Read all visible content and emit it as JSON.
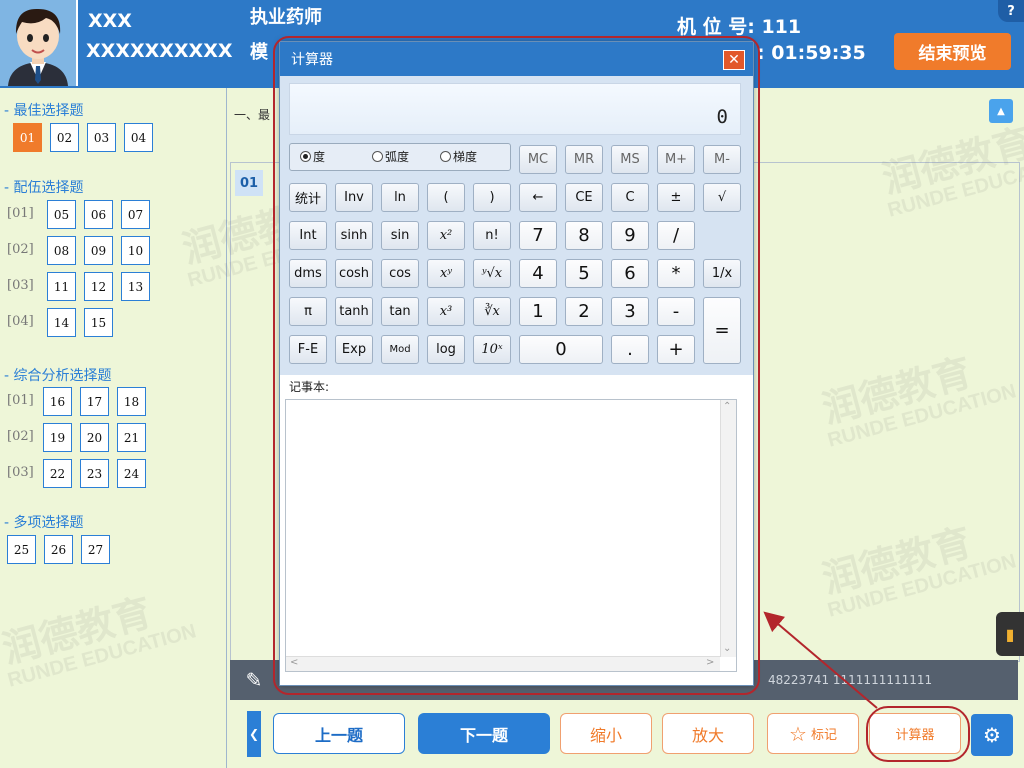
{
  "header": {
    "user_name": "XXX",
    "user_id": "XXXXXXXXXX",
    "exam_title": "执业药师",
    "exam_mode": "模",
    "seat_label": "机 位 号: 111",
    "timer": ": 01:59:35",
    "end_button": "结束预览",
    "help_icon": "?"
  },
  "sidebar": {
    "sections": [
      {
        "title": "- 最佳选择题",
        "groups": [
          {
            "label": "",
            "items": [
              "01",
              "02",
              "03",
              "04"
            ]
          }
        ]
      },
      {
        "title": "- 配伍选择题",
        "groups": [
          {
            "label": "[01]",
            "items": [
              "05",
              "06",
              "07"
            ]
          },
          {
            "label": "[02]",
            "items": [
              "08",
              "09",
              "10"
            ]
          },
          {
            "label": "[03]",
            "items": [
              "11",
              "12",
              "13"
            ]
          },
          {
            "label": "[04]",
            "items": [
              "14",
              "15"
            ]
          }
        ]
      },
      {
        "title": "- 综合分析选择题",
        "groups": [
          {
            "label": "[01]",
            "items": [
              "16",
              "17",
              "18"
            ]
          },
          {
            "label": "[02]",
            "items": [
              "19",
              "20",
              "21"
            ]
          },
          {
            "label": "[03]",
            "items": [
              "22",
              "23",
              "24"
            ]
          }
        ]
      },
      {
        "title": "- 多项选择题",
        "groups": [
          {
            "label": "",
            "items": [
              "25",
              "26",
              "27"
            ]
          }
        ]
      }
    ],
    "active_item": "01"
  },
  "main": {
    "heading": "一、最",
    "question_number": "01",
    "status_text": "48223741 1111111111111"
  },
  "toolbar": {
    "prev": "上一题",
    "next": "下一题",
    "shrink": "缩小",
    "enlarge": "放大",
    "mark": "标记",
    "calculator": "计算器"
  },
  "calculator": {
    "title": "计算器",
    "close": "✕",
    "display": "0",
    "angle_modes": [
      "度",
      "弧度",
      "梯度"
    ],
    "selected_mode": "度",
    "memory_keys": [
      "MC",
      "MR",
      "MS",
      "M+",
      "M-"
    ],
    "rows": [
      [
        "统计",
        "Inv",
        "ln",
        "(",
        ")",
        "←",
        "CE",
        "C",
        "±",
        "√"
      ],
      [
        "Int",
        "sinh",
        "sin",
        "x²",
        "n!",
        "7",
        "8",
        "9",
        "/"
      ],
      [
        "dms",
        "cosh",
        "cos",
        "xʸ",
        "ʸ√x",
        "4",
        "5",
        "6",
        "*",
        "1/x"
      ],
      [
        "π",
        "tanh",
        "tan",
        "x³",
        "∛x",
        "1",
        "2",
        "3",
        "-"
      ],
      [
        "F-E",
        "Exp",
        "Mod",
        "log",
        "10ˣ",
        "0",
        ".",
        "+"
      ]
    ],
    "equals": "=",
    "notepad_label": "记事本:"
  },
  "watermark": {
    "cn": "润德教育",
    "en": "RUNDE EDUCATION"
  },
  "colors": {
    "primary": "#2d79c7",
    "accent": "#f07b2b",
    "annotation": "#b3262c",
    "background": "#eef6d8"
  }
}
